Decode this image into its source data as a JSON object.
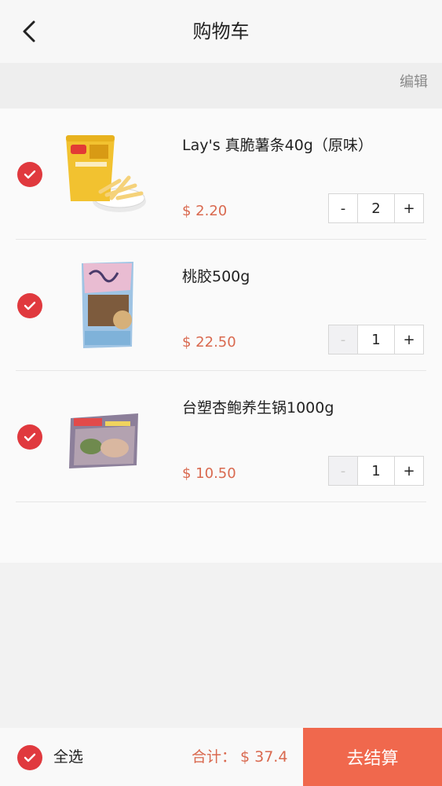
{
  "header": {
    "title": "购物车",
    "back_icon": "chevron-left-icon"
  },
  "toolbar": {
    "edit_label": "编辑"
  },
  "items": [
    {
      "name": "Lay's 真脆薯条40g（原味）",
      "price": "$ 2.20",
      "quantity": "2",
      "minus": "-",
      "plus": "+",
      "minus_disabled": false,
      "checked": true
    },
    {
      "name": "桃胶500g",
      "price": "$ 22.50",
      "quantity": "1",
      "minus": "-",
      "plus": "+",
      "minus_disabled": true,
      "checked": true
    },
    {
      "name": "台塑杏鲍养生锅1000g",
      "price": "$ 10.50",
      "quantity": "1",
      "minus": "-",
      "plus": "+",
      "minus_disabled": true,
      "checked": true
    }
  ],
  "footer": {
    "select_all_label": "全选",
    "total_label": "合计：",
    "total_value": "$ 37.4",
    "checkout_label": "去结算"
  },
  "colors": {
    "accent": "#e0393e",
    "price": "#d9694f",
    "checkout": "#f0684d"
  }
}
